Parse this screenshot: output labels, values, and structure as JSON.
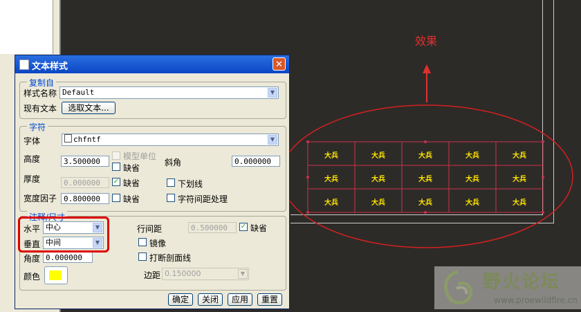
{
  "annotation": {
    "effect_label": "效果",
    "cell_text": "大兵",
    "table_rows": 3,
    "table_cols": 5
  },
  "watermark": {
    "title": "野火论坛",
    "url": "www.proewildfire.cn"
  },
  "dialog": {
    "title": "文本样式",
    "close_glyph": "✕",
    "copy_group": {
      "title": "复制自",
      "style_name_label": "样式名称",
      "style_name_value": "Default",
      "existing_text_label": "现有文本",
      "select_text_button": "选取文本..."
    },
    "char_group": {
      "title": "字符",
      "font_label": "字体",
      "font_value": "chfntf",
      "height_label": "高度",
      "height_value": "3.500000",
      "model_units_label": "模型单位",
      "default_label": "缺省",
      "slant_label": "斜角",
      "slant_value": "0.000000",
      "thickness_label": "厚度",
      "thickness_value": "0.000000",
      "underline_label": "下划线",
      "width_factor_label": "宽度因子",
      "width_factor_value": "0.800000",
      "kerning_label": "字符间距处理"
    },
    "note_group": {
      "title": "注释/尺寸",
      "horizontal_label": "水平",
      "horizontal_value": "中心",
      "vertical_label": "垂直",
      "vertical_value": "中间",
      "angle_label": "角度",
      "angle_value": "0.000000",
      "color_label": "颜色",
      "color_value": "#ffff00",
      "line_spacing_label": "行间距",
      "line_spacing_value": "0.500000",
      "default_label": "缺省",
      "mirror_label": "镜像",
      "break_hatch_label": "打断剖面线",
      "margin_label": "边距",
      "margin_value": "0.150000"
    },
    "buttons": {
      "ok": "确定",
      "close": "关闭",
      "apply": "应用",
      "reset": "重置"
    }
  },
  "colors": {
    "annotation_red": "#e03030",
    "canvas_bg": "#2d2b28",
    "text_yellow": "#ffe400"
  }
}
